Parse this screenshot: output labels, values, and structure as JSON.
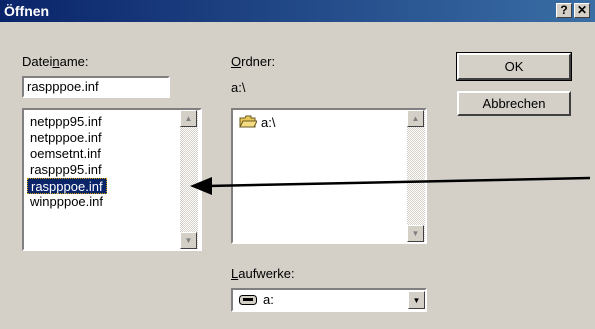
{
  "dialog": {
    "title": "Öffnen",
    "help_glyph": "?",
    "close_glyph": "✕"
  },
  "filename": {
    "label_before": "Datei",
    "label_accel": "n",
    "label_after": "ame:",
    "value": "raspppoe.inf"
  },
  "files": {
    "items": [
      "netppp95.inf",
      "netpppoe.inf",
      "oemsetnt.inf",
      "rasppp95.inf",
      "raspppoe.inf",
      "winpppoe.inf"
    ],
    "selected_index": 4
  },
  "folder": {
    "label_accel": "O",
    "label_rest": "rdner:",
    "path": "a:\\",
    "tree": [
      {
        "label": "a:\\",
        "icon": "open-folder-icon"
      }
    ]
  },
  "drives": {
    "label_accel": "L",
    "label_rest": "aufwerke:",
    "value": "a:",
    "icon": "floppy-drive-icon"
  },
  "buttons": {
    "ok": "OK",
    "cancel": "Abbrechen"
  },
  "annotation": {
    "icon": "arrow-pointer-annotation",
    "color": "#000000"
  },
  "colors": {
    "titlebar_start": "#0a246a",
    "titlebar_end": "#3a6ea5",
    "selection": "#0a246a",
    "face": "#d4d0c8"
  }
}
